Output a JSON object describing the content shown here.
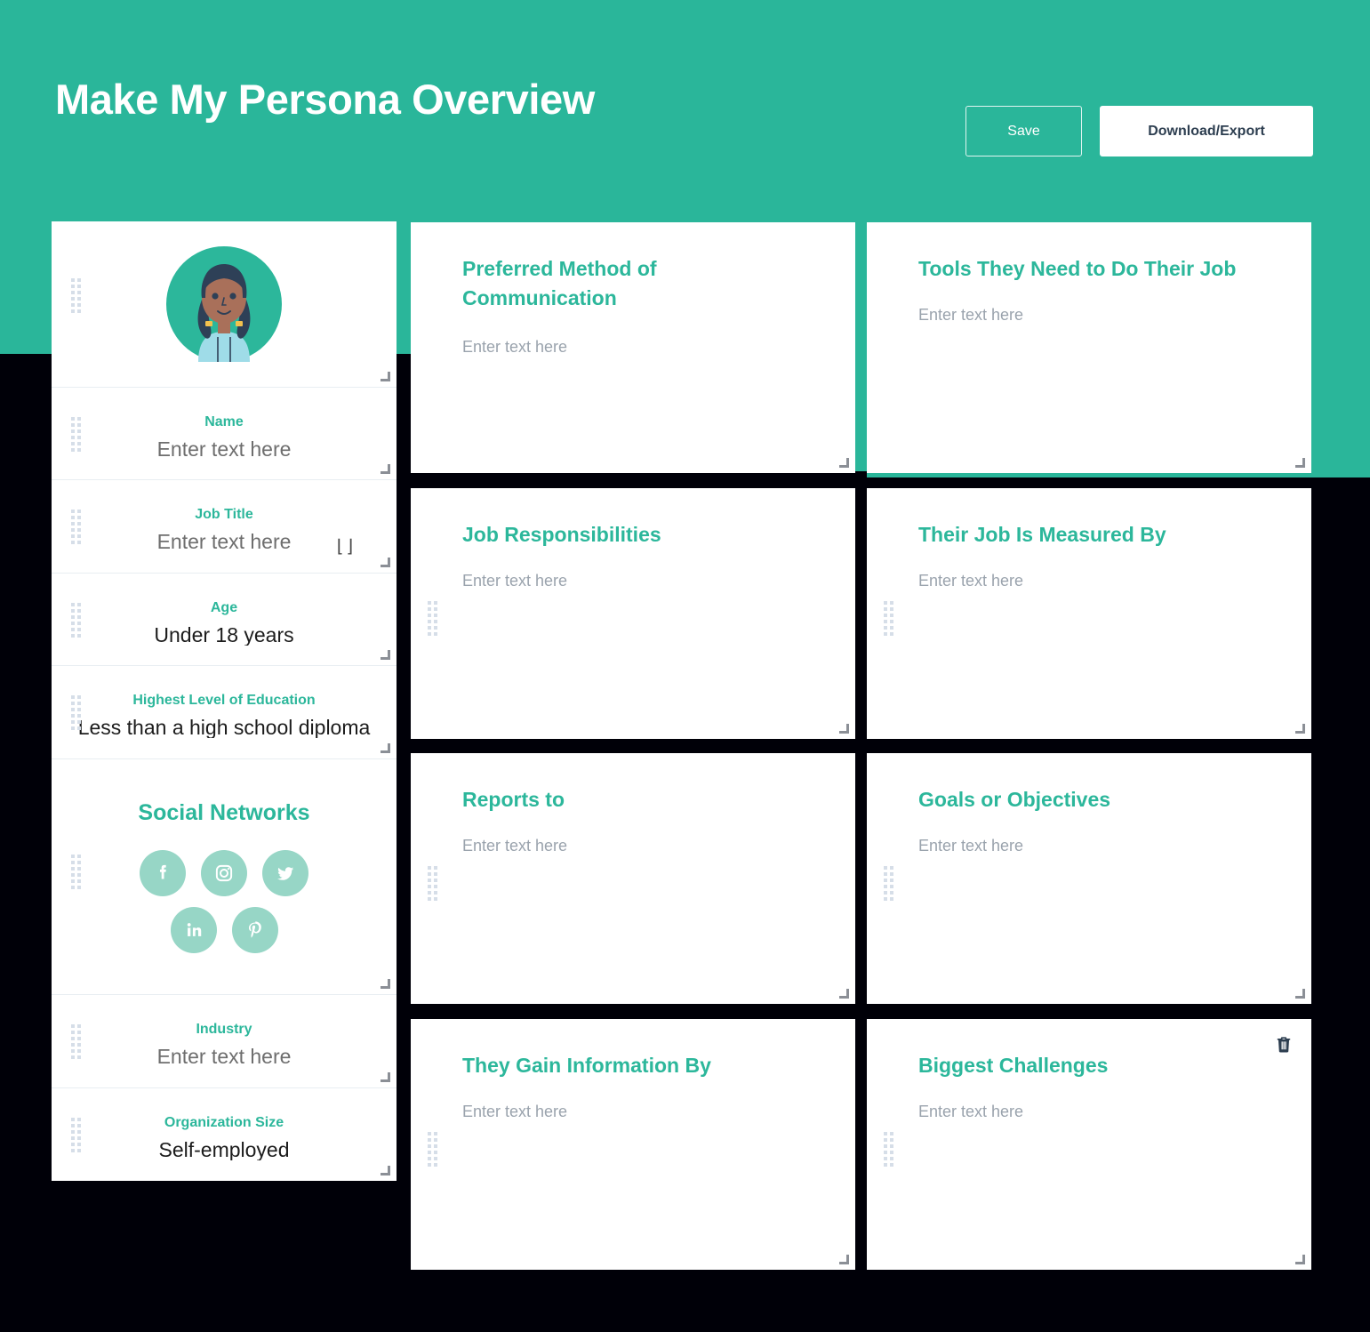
{
  "header": {
    "title": "Make My Persona Overview",
    "save_label": "Save",
    "download_label": "Download/Export"
  },
  "colors": {
    "brand_teal": "#2AB69A",
    "label_teal": "#2CB79B",
    "social_circle": "#97D6C6",
    "canvas_black": "#000008",
    "download_text": "#2D3E50",
    "placeholder_gray": "#9AA3AD"
  },
  "persona": {
    "avatar": {
      "icon": "avatar-woman-braids-icon",
      "bg_color": "#2CB79B",
      "hair_color": "#2E4057",
      "skin_color": "#A9705A",
      "shirt_color": "#9FDCE8",
      "tie_color": "#F2C14E"
    },
    "fields": [
      {
        "label": "Name",
        "value": "Enter text here",
        "is_placeholder": true
      },
      {
        "label": "Job Title",
        "value": "Enter text here",
        "is_placeholder": true
      },
      {
        "label": "Age",
        "value": "Under 18 years",
        "is_placeholder": false
      },
      {
        "label": "Highest Level of Education",
        "value": "Less than a high school diploma",
        "is_placeholder": false
      }
    ],
    "social": {
      "title": "Social Networks",
      "icons": [
        {
          "name": "facebook-icon",
          "label": "Facebook"
        },
        {
          "name": "instagram-icon",
          "label": "Instagram"
        },
        {
          "name": "twitter-icon",
          "label": "Twitter"
        },
        {
          "name": "linkedin-icon",
          "label": "LinkedIn"
        },
        {
          "name": "pinterest-icon",
          "label": "Pinterest"
        }
      ]
    },
    "fields_lower": [
      {
        "label": "Industry",
        "value": "Enter text here",
        "is_placeholder": true
      },
      {
        "label": "Organization Size",
        "value": "Self-employed",
        "is_placeholder": false
      }
    ]
  },
  "cards": [
    {
      "title": "Preferred Method of Communication",
      "placeholder": "Enter text here",
      "has_trash": false
    },
    {
      "title": "Tools They Need to Do Their Job",
      "placeholder": "Enter text here",
      "has_trash": false
    },
    {
      "title": "Job Responsibilities",
      "placeholder": "Enter text here",
      "has_trash": false
    },
    {
      "title": "Their Job Is Measured By",
      "placeholder": "Enter text here",
      "has_trash": false
    },
    {
      "title": "Reports to",
      "placeholder": "Enter text here",
      "has_trash": false
    },
    {
      "title": "Goals or Objectives",
      "placeholder": "Enter text here",
      "has_trash": false
    },
    {
      "title": "They Gain Information By",
      "placeholder": "Enter text here",
      "has_trash": false
    },
    {
      "title": "Biggest Challenges",
      "placeholder": "Enter text here",
      "has_trash": true
    }
  ]
}
